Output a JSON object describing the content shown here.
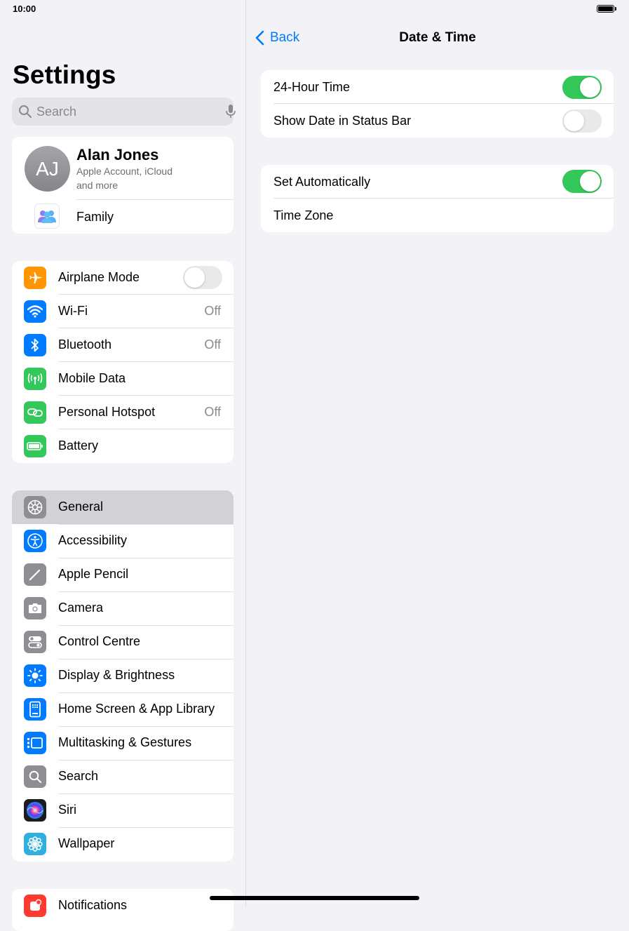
{
  "status": {
    "time": "10:00"
  },
  "sidebar": {
    "title": "Settings",
    "search_placeholder": "Search",
    "profile": {
      "initials": "AJ",
      "name": "Alan Jones",
      "subtitle_line1": "Apple Account, iCloud",
      "subtitle_line2": "and more",
      "family_label": "Family"
    },
    "connectivity": [
      {
        "label": "Airplane Mode",
        "icon": "airplane-icon",
        "color": "#ff9500",
        "toggle": false
      },
      {
        "label": "Wi-Fi",
        "icon": "wifi-icon",
        "color": "#007aff",
        "value": "Off"
      },
      {
        "label": "Bluetooth",
        "icon": "bluetooth-icon",
        "color": "#007aff",
        "value": "Off"
      },
      {
        "label": "Mobile Data",
        "icon": "antenna-icon",
        "color": "#34c759"
      },
      {
        "label": "Personal Hotspot",
        "icon": "hotspot-icon",
        "color": "#34c759",
        "value": "Off"
      },
      {
        "label": "Battery",
        "icon": "battery-icon",
        "color": "#34c759"
      }
    ],
    "general_items": [
      {
        "label": "General",
        "icon": "gear-icon",
        "color": "#8e8e93",
        "selected": true
      },
      {
        "label": "Accessibility",
        "icon": "accessibility-icon",
        "color": "#007aff"
      },
      {
        "label": "Apple Pencil",
        "icon": "pencil-icon",
        "color": "#8e8e93"
      },
      {
        "label": "Camera",
        "icon": "camera-icon",
        "color": "#8e8e93"
      },
      {
        "label": "Control Centre",
        "icon": "switches-icon",
        "color": "#8e8e93"
      },
      {
        "label": "Display & Brightness",
        "icon": "sun-icon",
        "color": "#007aff"
      },
      {
        "label": "Home Screen & App Library",
        "icon": "home-screen-icon",
        "color": "#007aff"
      },
      {
        "label": "Multitasking & Gestures",
        "icon": "multitasking-icon",
        "color": "#007aff"
      },
      {
        "label": "Search",
        "icon": "search-icon",
        "color": "#8e8e93"
      },
      {
        "label": "Siri",
        "icon": "siri-icon",
        "color": "#222222"
      },
      {
        "label": "Wallpaper",
        "icon": "flower-icon",
        "color": "#30b0e0"
      }
    ],
    "notifications_label": "Notifications"
  },
  "detail": {
    "back_label": "Back",
    "title": "Date & Time",
    "group1": [
      {
        "label": "24-Hour Time",
        "toggle": true
      },
      {
        "label": "Show Date in Status Bar",
        "toggle": false
      }
    ],
    "group2": [
      {
        "label": "Set Automatically",
        "toggle": true
      },
      {
        "label": "Time Zone"
      }
    ]
  },
  "colors": {
    "accent": "#007aff",
    "toggle_on": "#34c759",
    "background": "#f2f2f7"
  }
}
